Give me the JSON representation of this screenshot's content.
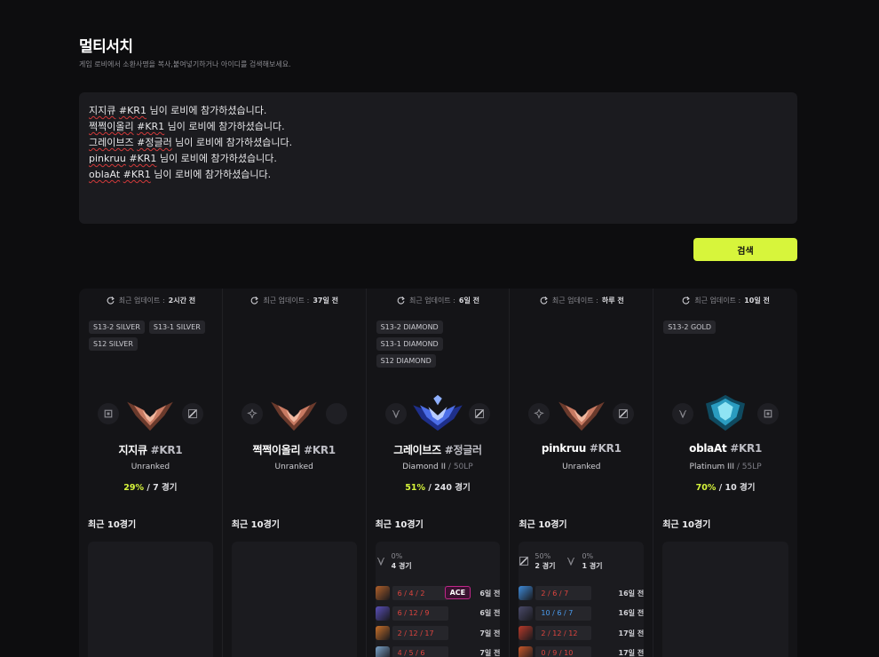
{
  "page": {
    "title": "멀티서치",
    "subtitle": "게임 로비에서 소환사명을 복사,붙여넣기하거나 아이디를 검색해보세요.",
    "search_label": "검색"
  },
  "lobby_lines": [
    {
      "name": "지지큐",
      "tag": "#KR1",
      "text": " 님이 로비에 참가하셨습니다."
    },
    {
      "name": "쩍쩍이올리",
      "tag": "#KR1",
      "text": " 님이 로비에 참가하셨습니다."
    },
    {
      "name": "그레이브즈",
      "tag": "#정글러",
      "text": " 님이 로비에 참가하셨습니다."
    },
    {
      "name": "pinkruu",
      "tag": "#KR1",
      "text": " 님이 로비에 참가하셨습니다."
    },
    {
      "name": "oblaAt",
      "tag": "#KR1",
      "text": " 님이 로비에 참가하셨습니다."
    }
  ],
  "labels": {
    "updated": "최근 업데이트 :",
    "recent": "최근 10경기",
    "ace": "ACE"
  },
  "colors": {
    "accent": "#d7f53b",
    "win": "#4a9cf0",
    "loss": "#e0453f",
    "ace": "#c1268a"
  },
  "players": [
    {
      "updated": "2시간 전",
      "tags": [
        "S13-2 SILVER",
        "S13-1 SILVER",
        "S12 SILVER"
      ],
      "emblem": "silver",
      "pos_left": "support-icon",
      "pos_right": "mid-icon",
      "name": "지지큐",
      "tag": "#KR1",
      "rank": "Unranked",
      "lp": "",
      "winrate": "29%",
      "games": "/ 7 경기",
      "recent_summary": [],
      "recent_games": []
    },
    {
      "updated": "37일 전",
      "tags": [],
      "emblem": "silver",
      "pos_left": "bot-icon",
      "pos_right": "",
      "name": "쩍쩍이올리",
      "tag": "#KR1",
      "rank": "Unranked",
      "lp": "",
      "winrate": "",
      "games": "",
      "recent_summary": [],
      "recent_games": []
    },
    {
      "updated": "6일 전",
      "tags": [
        "S13-2 DIAMOND",
        "S13-1 DIAMOND",
        "S12 DIAMOND"
      ],
      "emblem": "diamond",
      "pos_left": "jungle-icon",
      "pos_right": "mid-icon",
      "name": "그레이브즈",
      "tag": "#정글러",
      "rank": "Diamond II",
      "lp": "/ 50LP",
      "winrate": "51%",
      "games": "/ 240 경기",
      "recent_summary": [
        {
          "icon": "jungle-icon",
          "pct": "0%",
          "games": "4 경기"
        }
      ],
      "recent_games": [
        {
          "champ": "#b0602a",
          "kda": "6 / 4 / 2",
          "result": "loss",
          "ace": true,
          "ago": "6일 전"
        },
        {
          "champ": "#5a4fb8",
          "kda": "6 / 12 / 9",
          "result": "loss",
          "ace": false,
          "ago": "6일 전"
        },
        {
          "champ": "#c8702a",
          "kda": "2 / 12 / 17",
          "result": "loss",
          "ace": false,
          "ago": "7일 전"
        },
        {
          "champ": "#7aa2c8",
          "kda": "4 / 5 / 6",
          "result": "loss",
          "ace": false,
          "ago": "7일 전"
        }
      ]
    },
    {
      "updated": "하루 전",
      "tags": [],
      "emblem": "silver",
      "pos_left": "bot-icon",
      "pos_right": "mid-icon",
      "name": "pinkruu",
      "tag": "#KR1",
      "rank": "Unranked",
      "lp": "",
      "winrate": "",
      "games": "",
      "recent_summary": [
        {
          "icon": "mid-icon",
          "pct": "50%",
          "games": "2 경기"
        },
        {
          "icon": "jungle-icon",
          "pct": "0%",
          "games": "1 경기"
        }
      ],
      "recent_games": [
        {
          "champ": "#3e8ad8",
          "kda": "2 / 6 / 7",
          "result": "loss",
          "ace": false,
          "ago": "16일 전"
        },
        {
          "champ": "#4a4a6a",
          "kda": "10 / 6 / 7",
          "result": "win",
          "ace": false,
          "ago": "16일 전"
        },
        {
          "champ": "#b83a2a",
          "kda": "2 / 12 / 12",
          "result": "loss",
          "ace": false,
          "ago": "17일 전"
        },
        {
          "champ": "#c8582a",
          "kda": "0 / 9 / 10",
          "result": "loss",
          "ace": false,
          "ago": "17일 전"
        }
      ]
    },
    {
      "updated": "10일 전",
      "tags": [
        "S13-2 GOLD"
      ],
      "emblem": "platinum",
      "pos_left": "jungle-icon",
      "pos_right": "support-icon",
      "name": "oblaAt",
      "tag": "#KR1",
      "rank": "Platinum III",
      "lp": "/ 55LP",
      "winrate": "70%",
      "games": "/ 10 경기",
      "recent_summary": [],
      "recent_games": []
    }
  ]
}
